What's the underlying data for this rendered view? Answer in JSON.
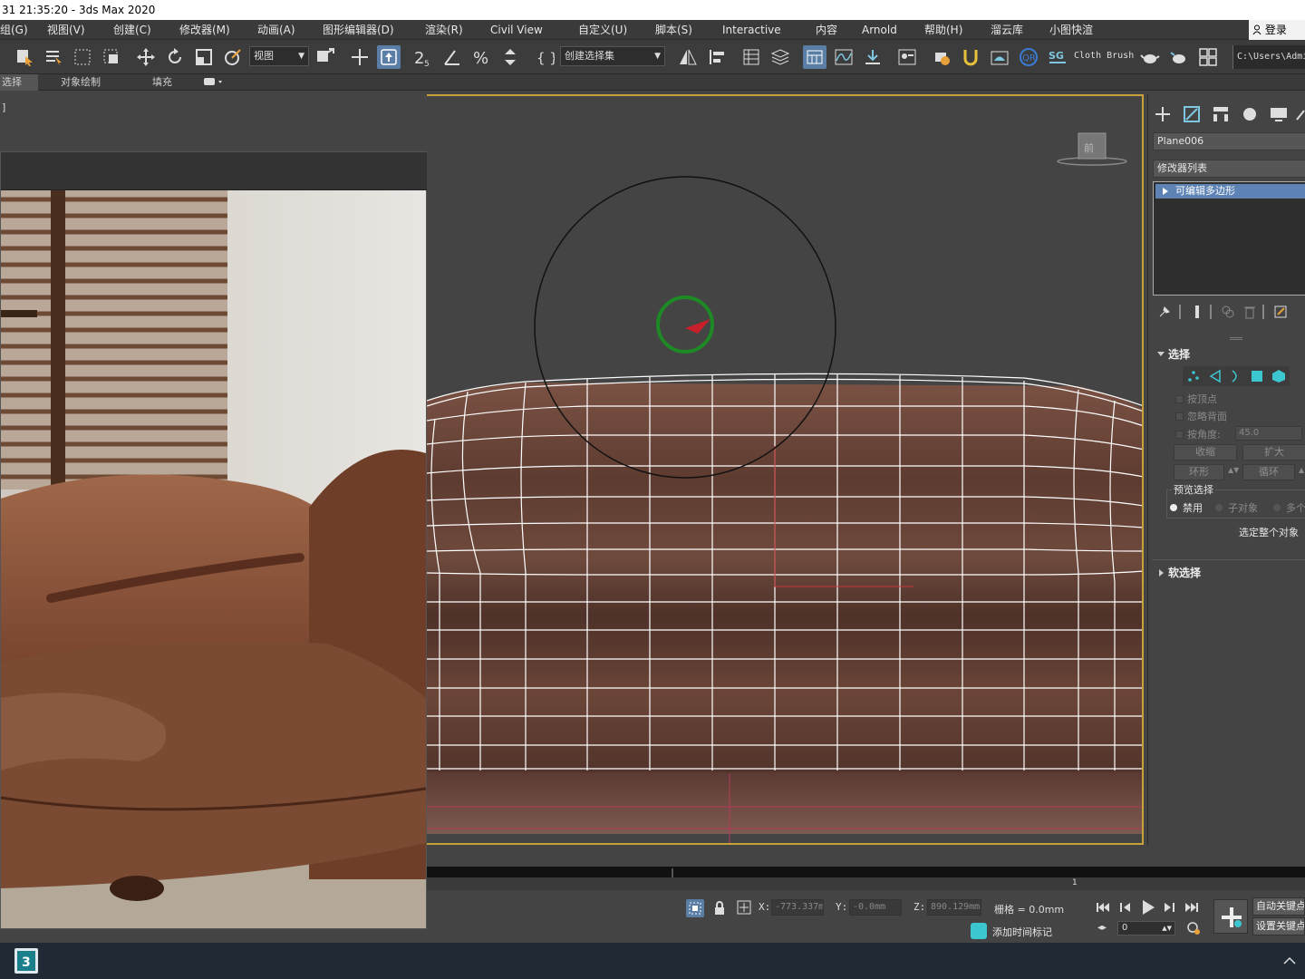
{
  "window": {
    "title": "31 21:35:20 - 3ds Max 2020"
  },
  "menu": {
    "items": [
      "组(G)",
      "视图(V)",
      "创建(C)",
      "修改器(M)",
      "动画(A)",
      "图形编辑器(D)",
      "渲染(R)",
      "Civil View",
      "自定义(U)",
      "脚本(S)",
      "Interactive",
      "内容",
      "Arnold",
      "帮助(H)",
      "溜云库",
      "小图快渲"
    ],
    "login": "登录"
  },
  "toolbar": {
    "view_dropdown": "视图",
    "selection_set_dropdown": "创建选择集",
    "spinner_label": "2.5",
    "cloth_brush": "Cloth Brush",
    "path": "C:\\Users\\Admi"
  },
  "ribbon": {
    "tabs": [
      "选择",
      "对象绘制",
      "填充"
    ]
  },
  "viewport": {
    "label": "]",
    "viewcube_face": "前"
  },
  "command_panel": {
    "object_name": "Plane006",
    "modifier_list_label": "修改器列表",
    "modifier_stack": [
      "可编辑多边形"
    ],
    "selection_rollout": {
      "title": "选择",
      "by_vertex": "按顶点",
      "ignore_backfacing": "忽略背面",
      "by_angle": "按角度:",
      "angle_value": "45.0",
      "shrink": "收缩",
      "grow": "扩大",
      "ring": "环形",
      "loop": "循环",
      "preview_selection": "预览选择",
      "preview_options": [
        "禁用",
        "子对象",
        "多个"
      ],
      "select_whole_object": "选定整个对象"
    },
    "soft_selection_rollout": {
      "title": "软选择"
    }
  },
  "timeline": {
    "frame_marker": "1"
  },
  "status": {
    "x_label": "X:",
    "x_value": "-773.337m",
    "y_label": "Y:",
    "y_value": "-0.0mm",
    "z_label": "Z:",
    "z_value": "890.129mm",
    "grid": "栅格 = 0.0mm",
    "add_time_tag": "添加时间标记",
    "frame_value": "0",
    "auto_key": "自动关键点",
    "set_key": "设置关键点"
  },
  "colors": {
    "accent_active": "#5a7ea6",
    "viewport_border": "#c8a13a",
    "sofa_brown": "#6b4538",
    "modifier_selected": "#5d83b4"
  }
}
